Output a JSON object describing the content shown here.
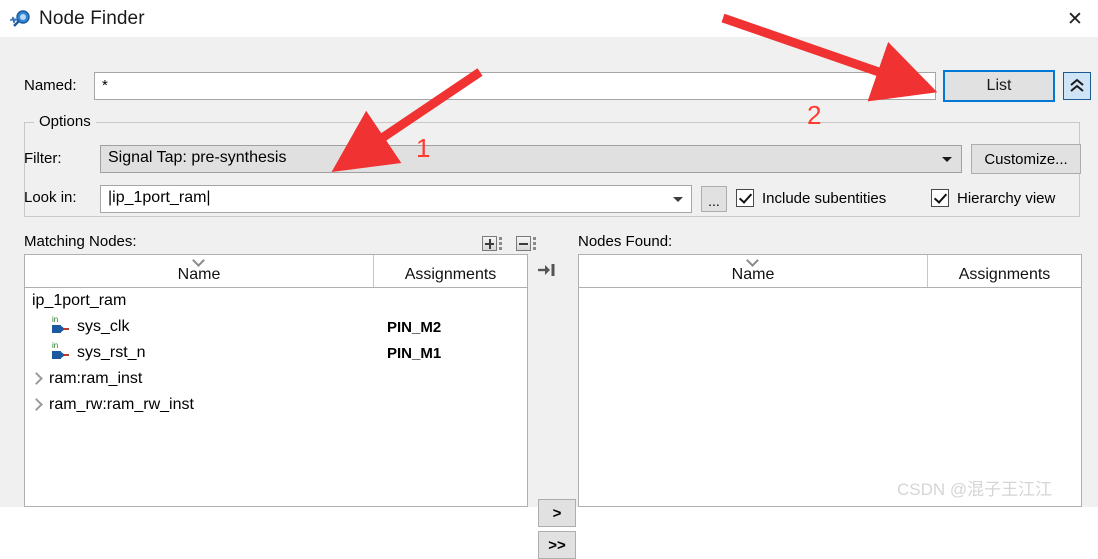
{
  "window": {
    "title": "Node Finder",
    "icon": "node-finder-icon",
    "close_label": "✕"
  },
  "named": {
    "label": "Named:",
    "value": "*",
    "list_button": "List",
    "collapse_button": "⌃"
  },
  "options": {
    "legend": "Options",
    "filter": {
      "label": "Filter:",
      "value": "Signal Tap: pre-synthesis",
      "customize_button": "Customize..."
    },
    "look_in": {
      "label": "Look in:",
      "value": "|ip_1port_ram|",
      "browse_button": "...",
      "include_subentities": {
        "label": "Include subentities",
        "checked": true
      },
      "hierarchy_view": {
        "label": "Hierarchy view",
        "checked": true
      }
    }
  },
  "matching_nodes": {
    "label": "Matching Nodes:",
    "expand_icon": "expand-all-icon",
    "collapse_icon": "collapse-all-icon",
    "side_icon": "move-to-found-icon",
    "columns": [
      "Name",
      "Assignments"
    ],
    "rows": [
      {
        "name": "ip_1port_ram",
        "assignment": "",
        "icon": "none",
        "indent": 0
      },
      {
        "name": "sys_clk",
        "assignment": "PIN_M2",
        "icon": "input-pin-icon",
        "indent": 1
      },
      {
        "name": "sys_rst_n",
        "assignment": "PIN_M1",
        "icon": "input-pin-icon",
        "indent": 1
      },
      {
        "name": "ram:ram_inst",
        "assignment": "",
        "icon": "chevron-right-icon",
        "indent": 0
      },
      {
        "name": "ram_rw:ram_rw_inst",
        "assignment": "",
        "icon": "chevron-right-icon",
        "indent": 0
      }
    ]
  },
  "nodes_found": {
    "label": "Nodes Found:",
    "columns": [
      "Name",
      "Assignments"
    ],
    "rows": []
  },
  "transfer": {
    "add_one": ">",
    "add_all": ">>"
  },
  "annotations": {
    "one": "1",
    "two": "2",
    "arrow_color": "#ff3b30"
  },
  "watermark": "CSDN @混子王江江"
}
